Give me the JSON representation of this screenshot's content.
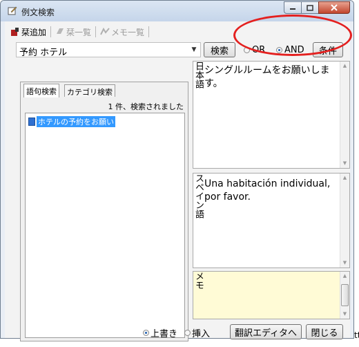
{
  "window": {
    "title": "例文検索"
  },
  "toolbar": {
    "add_label": "栞追加",
    "list_label": "栞一覧",
    "memo_list_label": "メモ一覧"
  },
  "search": {
    "value": "予約 ホテル",
    "search_button": "検索",
    "conditions_button": "条件"
  },
  "logic": {
    "or_label": "OR",
    "and_label": "AND",
    "selected": "AND"
  },
  "tabs": {
    "phrase": "語句検索",
    "category": "カテゴリ検索",
    "active": "語句検索"
  },
  "results": {
    "count_text": "1 件、検索されました",
    "items": [
      {
        "label": "ホテルの予約をお願い"
      }
    ]
  },
  "panes": {
    "japanese": {
      "label": "日本語",
      "text": "シングルルームをお願いします。"
    },
    "spanish": {
      "label": "スペイン語",
      "text": "Una habitación individual, por favor."
    },
    "memo": {
      "label": "メモ",
      "text": ""
    }
  },
  "bottom": {
    "overwrite_label": "上書き",
    "insert_label": "挿入",
    "selected_mode": "上書き",
    "editor_button": "翻訳エディタへ",
    "close_button": "閉じる"
  },
  "overflow_text": "tt",
  "colors": {
    "highlight_ring": "#e4201f",
    "selection": "#3399ff",
    "memo_bg": "#fffbd6"
  }
}
